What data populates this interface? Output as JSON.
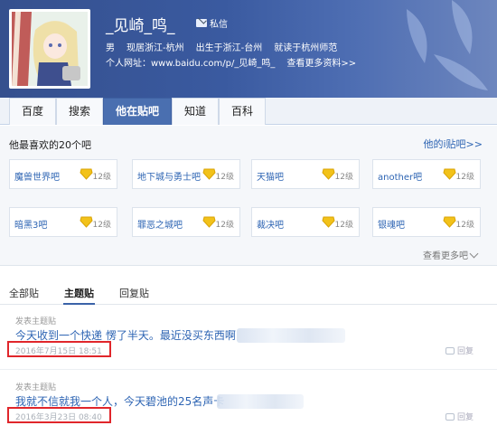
{
  "profile": {
    "username": "_见崎_鸣_",
    "message_label": "私信",
    "gender": "男",
    "residence": "现居浙江-杭州",
    "birthplace": "出生于浙江-台州",
    "school": "就读于杭州师范",
    "url_label": "个人网址：www.baidu.com/p/_见崎_鸣_",
    "more_info": "查看更多资料>>"
  },
  "tabs": [
    "百度",
    "搜索",
    "他在贴吧",
    "知道",
    "百科"
  ],
  "favorites": {
    "title": "他最喜欢的20个吧",
    "more_link": "他的i贴吧>>",
    "view_more": "查看更多吧",
    "bars": [
      {
        "name": "魔兽世界吧",
        "level": "12级"
      },
      {
        "name": "地下城与勇士吧",
        "level": "12级"
      },
      {
        "name": "天猫吧",
        "level": "12级"
      },
      {
        "name": "another吧",
        "level": "12级"
      },
      {
        "name": "暗黑3吧",
        "level": "12级"
      },
      {
        "name": "罪恶之城吧",
        "level": "12级"
      },
      {
        "name": "裁决吧",
        "level": "12级"
      },
      {
        "name": "银魂吧",
        "level": "12级"
      }
    ]
  },
  "post_tabs": [
    "全部贴",
    "主题贴",
    "回复贴"
  ],
  "posts": [
    {
      "label": "发表主题贴",
      "title": "今天收到一个快递 愣了半天。最近没买东西啊",
      "date": "2016年7月15日 18:51",
      "reply": "回复"
    },
    {
      "label": "发表主题贴",
      "title": "我就不信就我一个人，今天碧池的25名声卡",
      "date": "2016年3月23日 08:40",
      "reply": "回复"
    }
  ],
  "colors": {
    "header": "#3a5aa0",
    "link": "#2d64b3",
    "active_tab": "#4a6fb0",
    "highlight_box": "#e0262b",
    "badge": "#f2c21a"
  }
}
